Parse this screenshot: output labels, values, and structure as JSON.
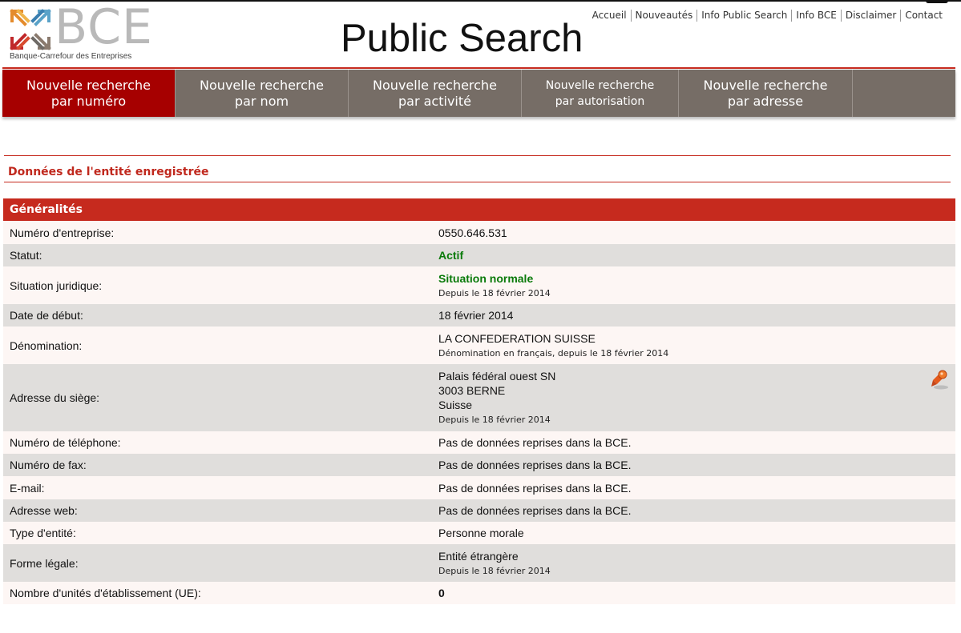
{
  "header": {
    "logo_letters": "BCE",
    "logo_caption": "Banque-Carrefour des Entreprises",
    "site_title": "Public Search",
    "top_links": [
      "Accueil",
      "Nouveautés",
      "Info Public Search",
      "Info BCE",
      "Disclaimer",
      "Contact"
    ]
  },
  "nav": {
    "tabs": [
      {
        "line1": "Nouvelle recherche",
        "line2": "par numéro"
      },
      {
        "line1": "Nouvelle recherche",
        "line2": "par nom"
      },
      {
        "line1": "Nouvelle recherche",
        "line2": "par activité"
      },
      {
        "line1": "Nouvelle recherche",
        "line2": "par autorisation"
      },
      {
        "line1": "Nouvelle recherche",
        "line2": "par adresse"
      }
    ]
  },
  "section": {
    "title": "Données de l'entité enregistrée"
  },
  "table": {
    "heading": "Généralités",
    "rows": {
      "enterprise_number": {
        "label": "Numéro d'entreprise:",
        "value": "0550.646.531"
      },
      "status": {
        "label": "Statut:",
        "value": "Actif"
      },
      "legal_situation": {
        "label": "Situation juridique:",
        "value": "Situation normale",
        "note": "Depuis le 18 février 2014"
      },
      "start_date": {
        "label": "Date de début:",
        "value": "18 février 2014"
      },
      "denomination": {
        "label": "Dénomination:",
        "value": "LA CONFEDERATION SUISSE",
        "note": "Dénomination en français, depuis le 18 février 2014"
      },
      "address": {
        "label": "Adresse du siège:",
        "line1": "Palais fédéral ouest SN",
        "line2": "3003 BERNE",
        "line3": "Suisse",
        "note": "Depuis le 18 février 2014"
      },
      "phone": {
        "label": "Numéro de téléphone:",
        "value": "Pas de données reprises dans la BCE."
      },
      "fax": {
        "label": "Numéro de fax:",
        "value": "Pas de données reprises dans la BCE."
      },
      "email": {
        "label": "E-mail:",
        "value": "Pas de données reprises dans la BCE."
      },
      "website": {
        "label": "Adresse web:",
        "value": "Pas de données reprises dans la BCE."
      },
      "entity_type": {
        "label": "Type d'entité:",
        "value": "Personne morale"
      },
      "legal_form": {
        "label": "Forme légale:",
        "value": "Entité étrangère",
        "note": "Depuis le 18 février 2014"
      },
      "establishment_units": {
        "label": "Nombre d'unités d'établissement (UE):",
        "value": "0"
      }
    }
  },
  "colors": {
    "accent_red": "#c62a1e",
    "active_tab": "#a60000",
    "nav_gray": "#766d66",
    "status_green": "#0a7a0a"
  },
  "icons": {
    "map": "map-pin-icon",
    "logo": "bce-logo-arrows-icon"
  }
}
